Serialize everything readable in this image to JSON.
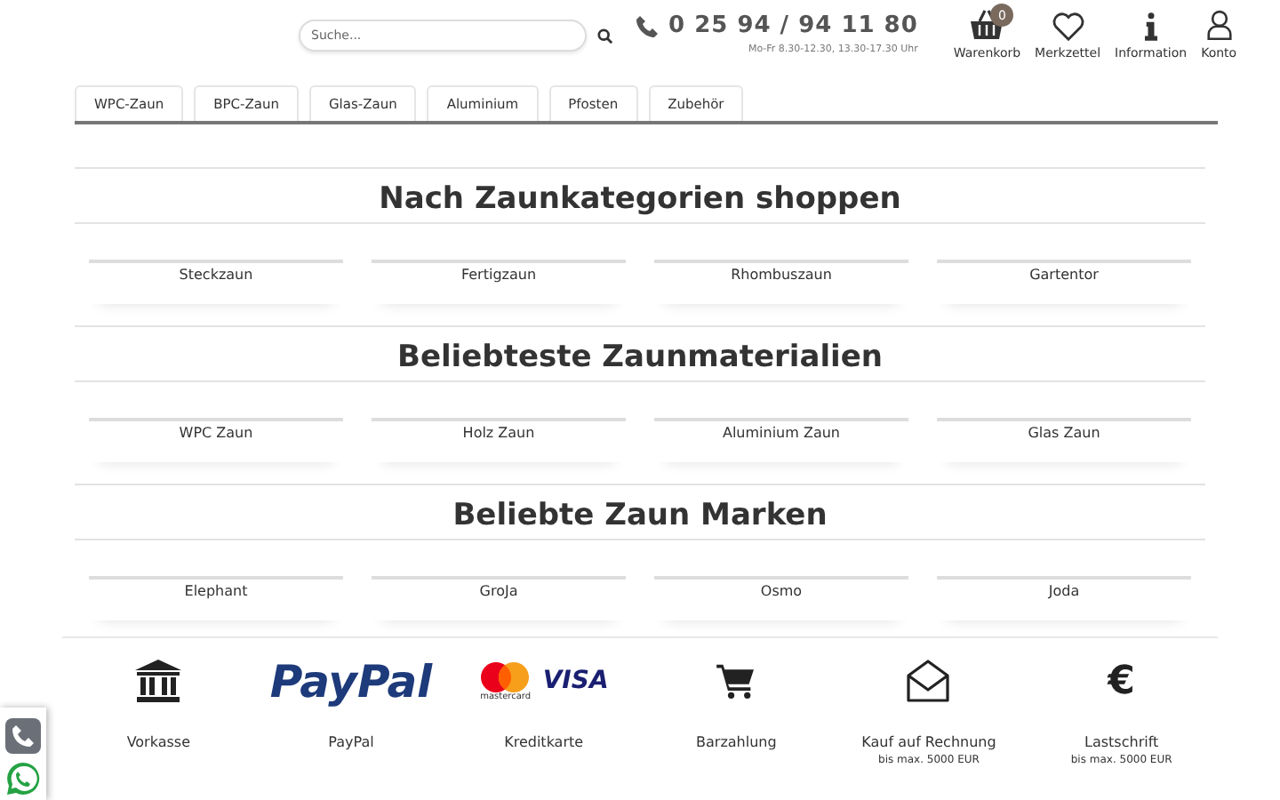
{
  "header": {
    "search": {
      "placeholder": "Suche..."
    },
    "phone": "0 25 94 / 94 11 80",
    "hours": "Mo-Fr 8.30-12.30, 13.30-17.30 Uhr",
    "actions": [
      {
        "kind": "basket",
        "label": "Warenkorb",
        "badge": "0"
      },
      {
        "kind": "heart",
        "label": "Merkzettel"
      },
      {
        "kind": "info",
        "label": "Information"
      },
      {
        "kind": "user",
        "label": "Konto"
      }
    ]
  },
  "nav": [
    {
      "label": "WPC-Zaun"
    },
    {
      "label": "BPC-Zaun"
    },
    {
      "label": "Glas-Zaun"
    },
    {
      "label": "Aluminium"
    },
    {
      "label": "Pfosten"
    },
    {
      "label": "Zubehör"
    }
  ],
  "sections": [
    {
      "title": "Nach Zaunkategorien shoppen",
      "items": [
        "Steckzaun",
        "Fertigzaun",
        "Rhombuszaun",
        "Gartentor"
      ]
    },
    {
      "title": "Beliebteste Zaunmaterialien",
      "items": [
        "WPC Zaun",
        "Holz Zaun",
        "Aluminium Zaun",
        "Glas Zaun"
      ]
    },
    {
      "title": "Beliebte Zaun Marken",
      "items": [
        "Elephant",
        "GroJa",
        "Osmo",
        "Joda"
      ]
    }
  ],
  "payments": [
    {
      "kind": "bank",
      "label": "Vorkasse"
    },
    {
      "kind": "paypal",
      "logo": "PayPal",
      "label": "PayPal"
    },
    {
      "kind": "cards",
      "logo": "VISA",
      "sublogo": "mastercard",
      "label": "Kreditkarte"
    },
    {
      "kind": "cart",
      "label": "Barzahlung"
    },
    {
      "kind": "envelope",
      "label": "Kauf auf Rechnung",
      "note": "bis max. 5000 EUR"
    },
    {
      "kind": "glyph",
      "logo": "€",
      "label": "Lastschrift",
      "note": "bis max. 5000 EUR"
    }
  ],
  "contact": [
    {
      "kind": "phone"
    },
    {
      "kind": "whatsapp"
    }
  ]
}
